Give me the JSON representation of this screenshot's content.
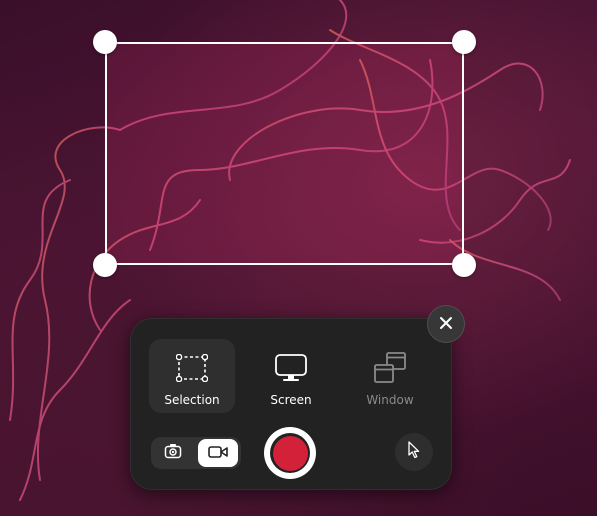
{
  "wallpaper": {
    "description_colors": {
      "base": "#3d0f2b",
      "accent": "#e0507f"
    }
  },
  "selection_overlay": {
    "border_color": "#ffffff"
  },
  "panel": {
    "modes": [
      {
        "label": "Selection",
        "icon": "selection-icon",
        "active": true
      },
      {
        "label": "Screen",
        "icon": "monitor-icon",
        "active": false
      },
      {
        "label": "Window",
        "icon": "window-icon",
        "active": false
      }
    ],
    "capture_type": {
      "options": [
        {
          "icon": "camera-icon",
          "selected": false
        },
        {
          "icon": "video-camera-icon",
          "selected": true
        }
      ]
    },
    "record_button": {
      "color": "#d4213a"
    },
    "pointer_toggle": {
      "icon": "mouse-pointer-icon"
    },
    "close_button": {
      "icon": "close-icon"
    }
  }
}
